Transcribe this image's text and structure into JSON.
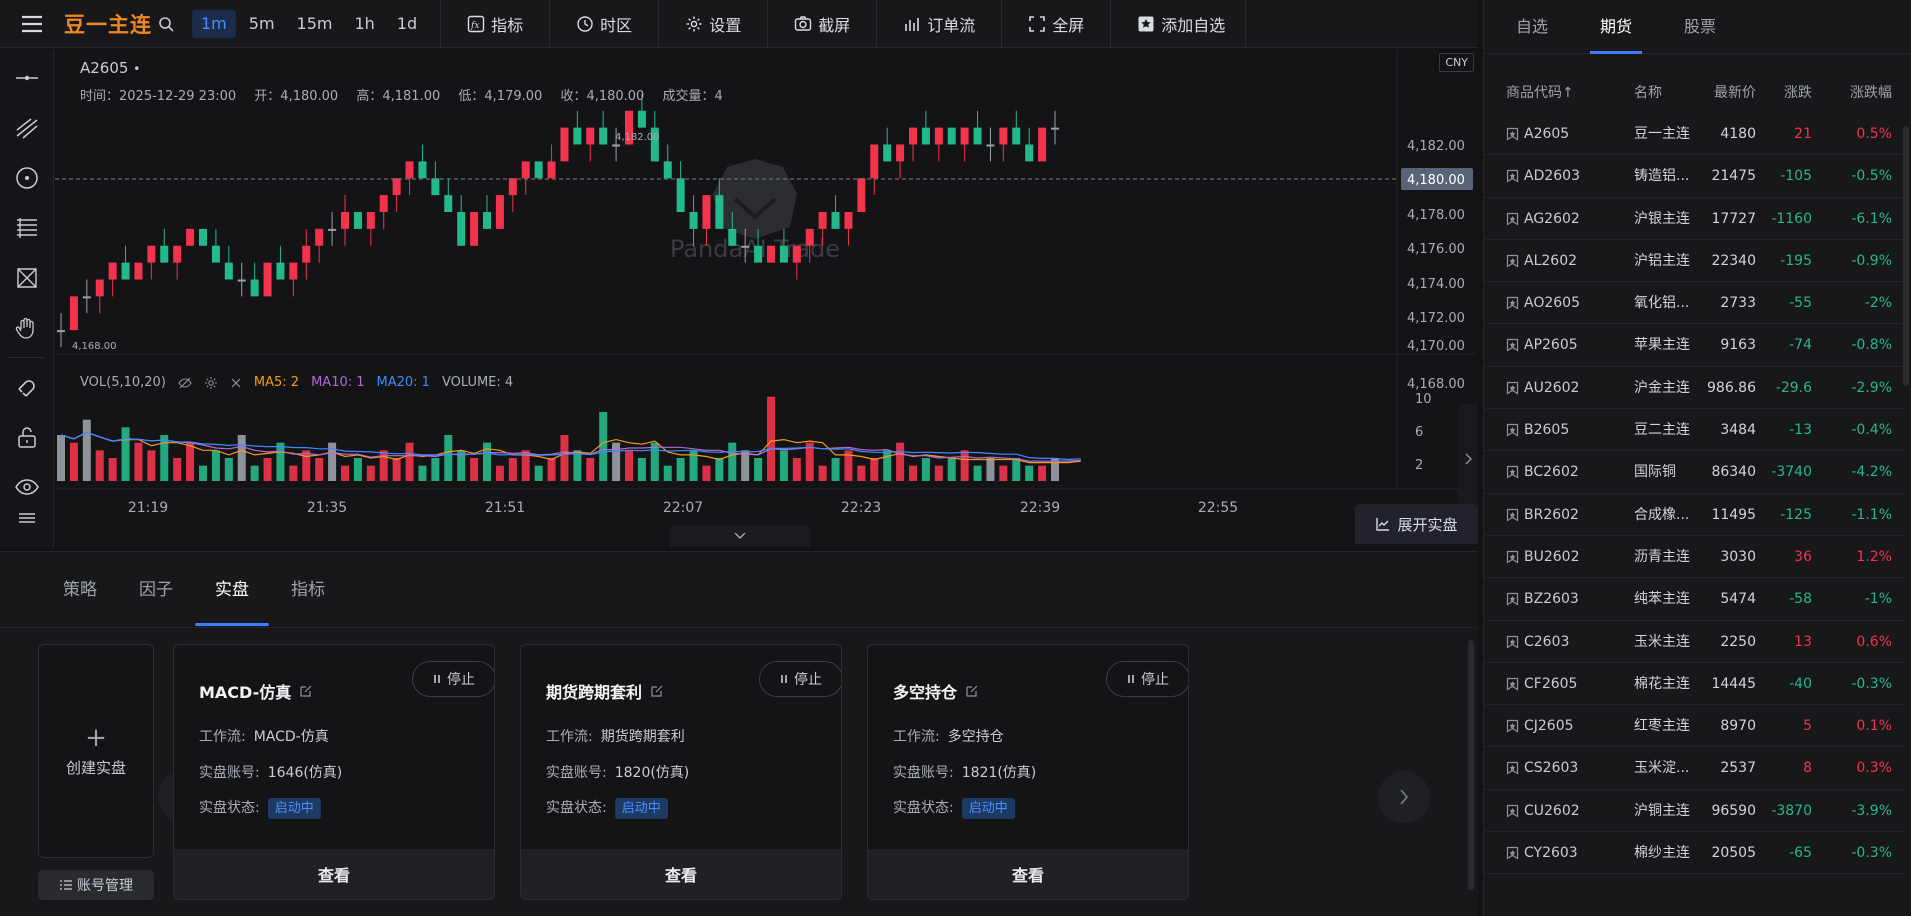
{
  "toolbar": {
    "symbol_title": "豆一主连",
    "periods": [
      "1m",
      "5m",
      "15m",
      "1h",
      "1d"
    ],
    "buttons": {
      "indicator": "指标",
      "timezone": "时区",
      "settings": "设置",
      "screenshot": "截屏",
      "orderflow": "订单流",
      "fullscreen": "全屏",
      "add_watch": "添加自选"
    }
  },
  "chart": {
    "symbol": "A2605",
    "symbol_dot": "•",
    "currency": "CNY",
    "info": {
      "time": "时间：2025-12-29 23:00",
      "open": "开：4,180.00",
      "high": "高：4,181.00",
      "low": "低：4,179.00",
      "close": "收：4,180.00",
      "volume": "成交量：4"
    },
    "watermark": "PandaAI Trade",
    "price_ticks": [
      "4,182.00",
      "4,180.00",
      "4,178.00",
      "4,176.00",
      "4,174.00",
      "4,172.00",
      "4,170.00",
      "4,168.00"
    ],
    "last_price": "4,180.00",
    "high_mark": "4,182.00",
    "low_mark": "4,168.00",
    "vol_legend": {
      "title": "VOL(5,10,20)",
      "ma5": "MA5: 2",
      "ma10": "MA10: 1",
      "ma20": "MA20: 1",
      "volume": "VOLUME: 4"
    },
    "vol_ticks": [
      "10",
      "6",
      "2"
    ],
    "time_ticks": [
      "21:19",
      "21:35",
      "21:51",
      "22:07",
      "22:23",
      "22:39",
      "22:55"
    ],
    "expand_label": "展开实盘"
  },
  "chart_data": {
    "type": "candlestick",
    "symbol": "A2605",
    "price_range": [
      4167,
      4183
    ],
    "volume_range": [
      0,
      12
    ],
    "time_range": [
      "21:13",
      "23:00"
    ],
    "grid": false,
    "candles_ohlc": [
      [
        4168,
        4169,
        4167,
        4168
      ],
      [
        4168,
        4170,
        4168,
        4170
      ],
      [
        4170,
        4171,
        4169,
        4170
      ],
      [
        4170,
        4171,
        4169,
        4171
      ],
      [
        4171,
        4172,
        4170,
        4172
      ],
      [
        4172,
        4173,
        4171,
        4171
      ],
      [
        4171,
        4172,
        4171,
        4172
      ],
      [
        4172,
        4173,
        4171,
        4173
      ],
      [
        4173,
        4174,
        4172,
        4172
      ],
      [
        4172,
        4173,
        4171,
        4173
      ],
      [
        4173,
        4174,
        4173,
        4174
      ],
      [
        4174,
        4174,
        4173,
        4173
      ],
      [
        4173,
        4174,
        4172,
        4172
      ],
      [
        4172,
        4173,
        4171,
        4171
      ],
      [
        4171,
        4172,
        4170,
        4171
      ],
      [
        4171,
        4172,
        4170,
        4170
      ],
      [
        4170,
        4172,
        4170,
        4172
      ],
      [
        4172,
        4173,
        4171,
        4171
      ],
      [
        4171,
        4172,
        4170,
        4172
      ],
      [
        4172,
        4174,
        4171,
        4173
      ],
      [
        4173,
        4174,
        4172,
        4174
      ],
      [
        4174,
        4175,
        4173,
        4174
      ],
      [
        4174,
        4176,
        4173,
        4175
      ],
      [
        4175,
        4175,
        4174,
        4174
      ],
      [
        4174,
        4175,
        4173,
        4175
      ],
      [
        4175,
        4176,
        4174,
        4176
      ],
      [
        4176,
        4177,
        4175,
        4177
      ],
      [
        4177,
        4178,
        4176,
        4178
      ],
      [
        4178,
        4179,
        4177,
        4177
      ],
      [
        4177,
        4178,
        4176,
        4176
      ],
      [
        4176,
        4177,
        4175,
        4175
      ],
      [
        4175,
        4176,
        4173,
        4173
      ],
      [
        4173,
        4175,
        4173,
        4175
      ],
      [
        4175,
        4176,
        4174,
        4174
      ],
      [
        4174,
        4176,
        4174,
        4176
      ],
      [
        4176,
        4177,
        4175,
        4177
      ],
      [
        4177,
        4178,
        4176,
        4178
      ],
      [
        4178,
        4178,
        4177,
        4177
      ],
      [
        4177,
        4179,
        4177,
        4178
      ],
      [
        4178,
        4180,
        4178,
        4180
      ],
      [
        4180,
        4181,
        4179,
        4179
      ],
      [
        4179,
        4180,
        4178,
        4180
      ],
      [
        4180,
        4181,
        4179,
        4179
      ],
      [
        4179,
        4180,
        4178,
        4179
      ],
      [
        4179,
        4181,
        4179,
        4181
      ],
      [
        4181,
        4182,
        4180,
        4180
      ],
      [
        4180,
        4181,
        4178,
        4178
      ],
      [
        4178,
        4179,
        4177,
        4177
      ],
      [
        4177,
        4178,
        4175,
        4175
      ],
      [
        4175,
        4176,
        4173,
        4174
      ],
      [
        4174,
        4176,
        4173,
        4176
      ],
      [
        4176,
        4177,
        4174,
        4174
      ],
      [
        4174,
        4175,
        4173,
        4173
      ],
      [
        4173,
        4174,
        4172,
        4173
      ],
      [
        4173,
        4174,
        4172,
        4172
      ],
      [
        4172,
        4173,
        4172,
        4173
      ],
      [
        4173,
        4174,
        4172,
        4172
      ],
      [
        4172,
        4173,
        4171,
        4173
      ],
      [
        4173,
        4174,
        4172,
        4174
      ],
      [
        4174,
        4175,
        4173,
        4175
      ],
      [
        4175,
        4176,
        4174,
        4174
      ],
      [
        4174,
        4175,
        4173,
        4175
      ],
      [
        4175,
        4177,
        4175,
        4177
      ],
      [
        4177,
        4179,
        4176,
        4179
      ],
      [
        4179,
        4180,
        4178,
        4178
      ],
      [
        4178,
        4179,
        4177,
        4179
      ],
      [
        4179,
        4180,
        4178,
        4180
      ],
      [
        4180,
        4181,
        4179,
        4179
      ],
      [
        4179,
        4180,
        4178,
        4180
      ],
      [
        4180,
        4180,
        4179,
        4179
      ],
      [
        4179,
        4180,
        4178,
        4180
      ],
      [
        4180,
        4181,
        4179,
        4179
      ],
      [
        4179,
        4180,
        4178,
        4179
      ],
      [
        4179,
        4180,
        4178,
        4180
      ],
      [
        4180,
        4181,
        4179,
        4179
      ],
      [
        4179,
        4180,
        4178,
        4178
      ],
      [
        4178,
        4180,
        4178,
        4180
      ],
      [
        4180,
        4181,
        4179,
        4180
      ]
    ],
    "volume_values": [
      6,
      5,
      8,
      4,
      3,
      7,
      5,
      4,
      6,
      3,
      5,
      2,
      4,
      3,
      6,
      2,
      3,
      5,
      2,
      4,
      3,
      5,
      2,
      3,
      2,
      4,
      3,
      5,
      2,
      3,
      6,
      4,
      3,
      5,
      2,
      3,
      4,
      2,
      3,
      6,
      4,
      3,
      9,
      5,
      4,
      3,
      5,
      2,
      3,
      4,
      2,
      3,
      5,
      4,
      3,
      11,
      4,
      3,
      5,
      2,
      3,
      4,
      2,
      3,
      4,
      5,
      2,
      3,
      2,
      3,
      4,
      2,
      3,
      2,
      3,
      2,
      2,
      3,
      2,
      4
    ],
    "volume_colors_note": "up bars red, down bars green, neutral grey",
    "ma_lines": [
      "MA5",
      "MA10",
      "MA20"
    ]
  },
  "bottom": {
    "tabs": [
      "策略",
      "因子",
      "实盘",
      "指标"
    ],
    "active_tab": "实盘",
    "create_label": "创建实盘",
    "create_plus": "+",
    "account_mgmt": "账号管理",
    "cards": [
      {
        "name": "MACD-仿真",
        "stop": "停止",
        "workflow_label": "工作流:",
        "workflow": "MACD-仿真",
        "account_label": "实盘账号:",
        "account": "1646(仿真)",
        "status_label": "实盘状态:",
        "status": "启动中",
        "view": "查看"
      },
      {
        "name": "期货跨期套利",
        "stop": "停止",
        "workflow_label": "工作流:",
        "workflow": "期货跨期套利",
        "account_label": "实盘账号:",
        "account": "1820(仿真)",
        "status_label": "实盘状态:",
        "status": "启动中",
        "view": "查看"
      },
      {
        "name": "多空持仓",
        "stop": "停止",
        "workflow_label": "工作流:",
        "workflow": "多空持仓",
        "account_label": "实盘账号:",
        "account": "1821(仿真)",
        "status_label": "实盘状态:",
        "status": "启动中",
        "view": "查看"
      }
    ]
  },
  "watchlist": {
    "tabs": [
      "自选",
      "期货",
      "股票"
    ],
    "active_tab": "期货",
    "headers": {
      "code": "商品代码↑",
      "name": "名称",
      "price": "最新价",
      "change": "涨跌",
      "pct": "涨跌幅"
    },
    "rows": [
      {
        "code": "A2605",
        "name": "豆一主连",
        "price": "4180",
        "change": "21",
        "pct": "0.5%",
        "dir": "up"
      },
      {
        "code": "AD2603",
        "name": "铸造铝...",
        "price": "21475",
        "change": "-105",
        "pct": "-0.5%",
        "dir": "down"
      },
      {
        "code": "AG2602",
        "name": "沪银主连",
        "price": "17727",
        "change": "-1160",
        "pct": "-6.1%",
        "dir": "down"
      },
      {
        "code": "AL2602",
        "name": "沪铝主连",
        "price": "22340",
        "change": "-195",
        "pct": "-0.9%",
        "dir": "down"
      },
      {
        "code": "AO2605",
        "name": "氧化铝...",
        "price": "2733",
        "change": "-55",
        "pct": "-2%",
        "dir": "down"
      },
      {
        "code": "AP2605",
        "name": "苹果主连",
        "price": "9163",
        "change": "-74",
        "pct": "-0.8%",
        "dir": "down"
      },
      {
        "code": "AU2602",
        "name": "沪金主连",
        "price": "986.86",
        "change": "-29.6",
        "pct": "-2.9%",
        "dir": "down"
      },
      {
        "code": "B2605",
        "name": "豆二主连",
        "price": "3484",
        "change": "-13",
        "pct": "-0.4%",
        "dir": "down"
      },
      {
        "code": "BC2602",
        "name": "国际铜",
        "price": "86340",
        "change": "-3740",
        "pct": "-4.2%",
        "dir": "down"
      },
      {
        "code": "BR2602",
        "name": "合成橡...",
        "price": "11495",
        "change": "-125",
        "pct": "-1.1%",
        "dir": "down"
      },
      {
        "code": "BU2602",
        "name": "沥青主连",
        "price": "3030",
        "change": "36",
        "pct": "1.2%",
        "dir": "up"
      },
      {
        "code": "BZ2603",
        "name": "纯苯主连",
        "price": "5474",
        "change": "-58",
        "pct": "-1%",
        "dir": "down"
      },
      {
        "code": "C2603",
        "name": "玉米主连",
        "price": "2250",
        "change": "13",
        "pct": "0.6%",
        "dir": "up"
      },
      {
        "code": "CF2605",
        "name": "棉花主连",
        "price": "14445",
        "change": "-40",
        "pct": "-0.3%",
        "dir": "down"
      },
      {
        "code": "CJ2605",
        "name": "红枣主连",
        "price": "8970",
        "change": "5",
        "pct": "0.1%",
        "dir": "up"
      },
      {
        "code": "CS2603",
        "name": "玉米淀...",
        "price": "2537",
        "change": "8",
        "pct": "0.3%",
        "dir": "up"
      },
      {
        "code": "CU2602",
        "name": "沪铜主连",
        "price": "96590",
        "change": "-3870",
        "pct": "-3.9%",
        "dir": "down"
      },
      {
        "code": "CY2603",
        "name": "棉纱主连",
        "price": "20505",
        "change": "-65",
        "pct": "-0.3%",
        "dir": "down"
      }
    ]
  },
  "colors": {
    "up": "#f2334d",
    "down": "#24b98a",
    "accent": "#3d7dff",
    "brand": "#f0891f",
    "ma5": "#f39b17",
    "ma10": "#b26ad6",
    "ma20": "#3d8bff"
  }
}
